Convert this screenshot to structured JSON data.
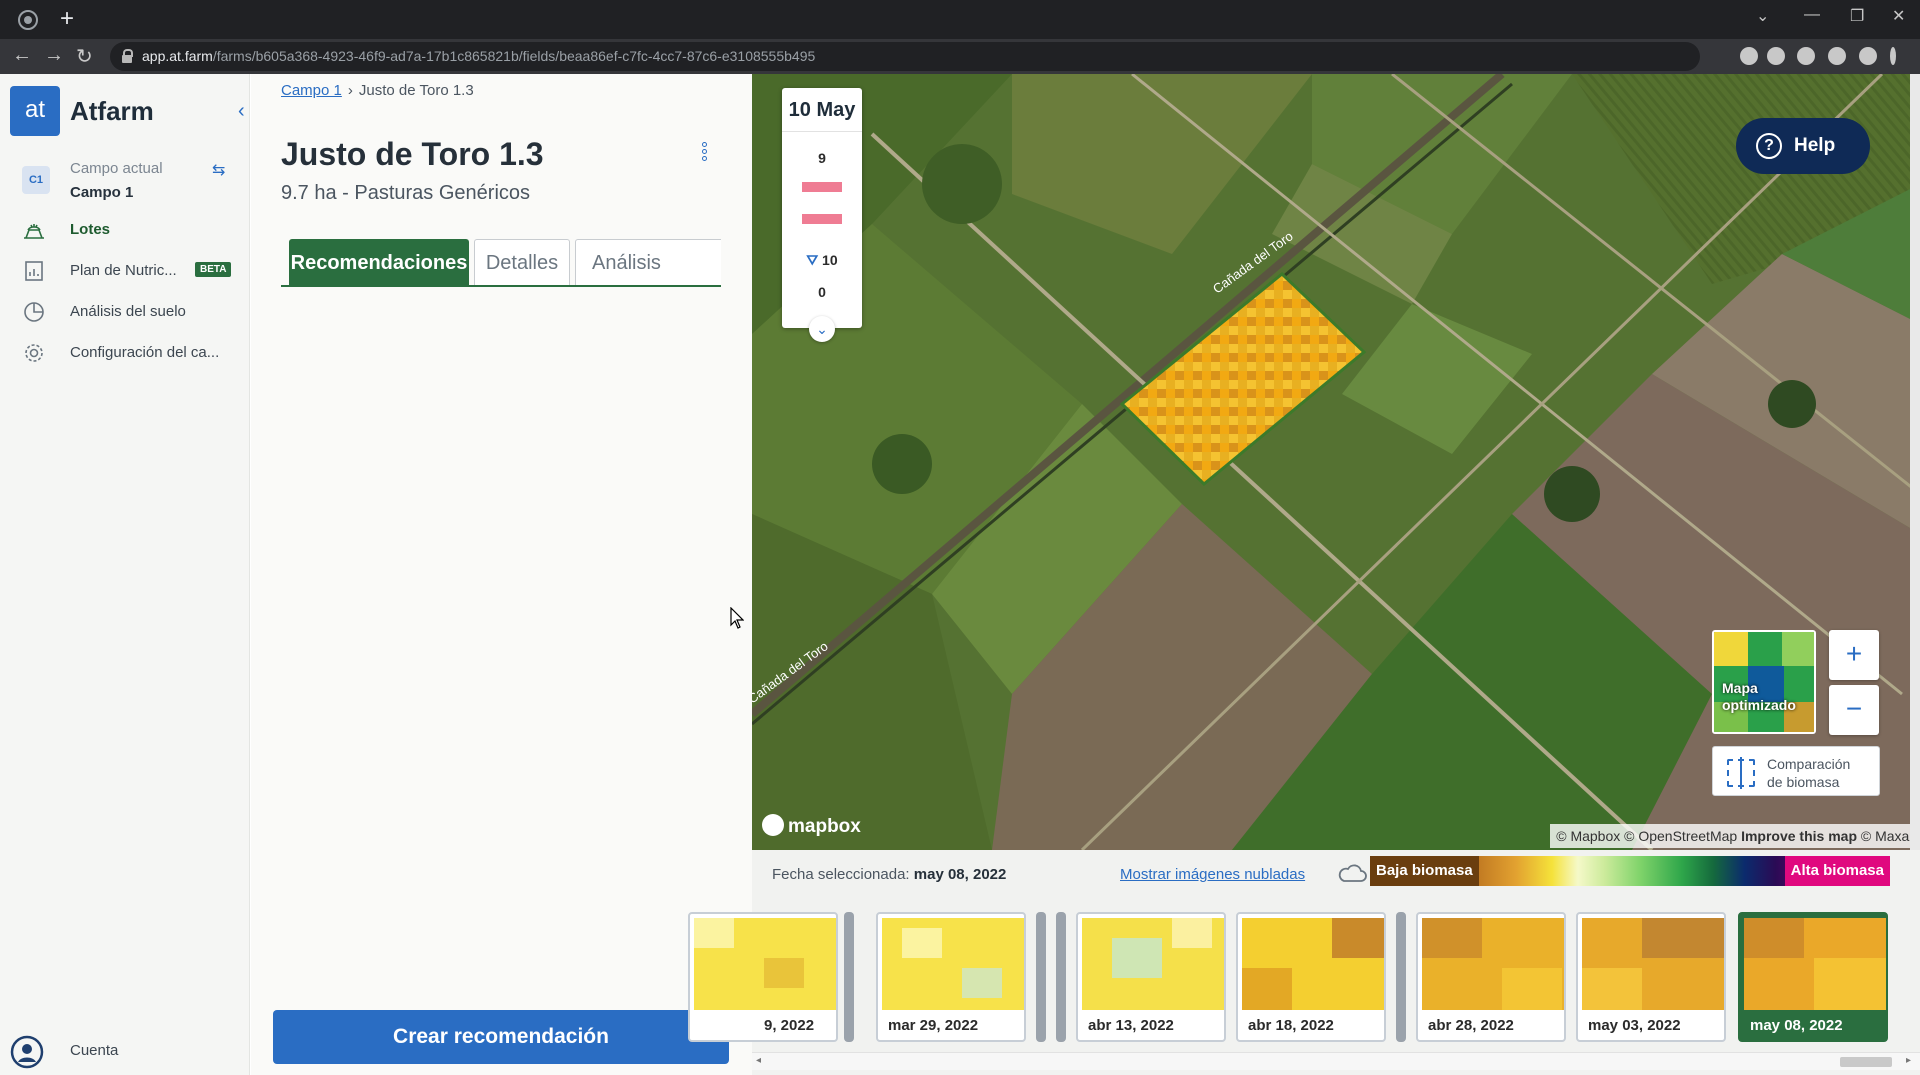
{
  "browser": {
    "url_host": "app.at.farm",
    "url_path": "/farms/b605a368-4923-46f9-ad7a-17b1c865821b/fields/beaa86ef-c7fc-4cc7-87c6-e3108555b495"
  },
  "sidebar": {
    "logo": "at",
    "app_name": "Atfarm",
    "farm_badge": "C1",
    "farm_label": "Campo actual",
    "farm_name": "Campo 1",
    "items": [
      {
        "label": "Lotes",
        "icon": "field-icon",
        "active": true
      },
      {
        "label": "Plan de Nutric...",
        "icon": "chart-icon",
        "badge": "BETA"
      },
      {
        "label": "Análisis del suelo",
        "icon": "soil-analysis-icon"
      },
      {
        "label": "Configuración del ca...",
        "icon": "gear-icon"
      }
    ],
    "account_label": "Cuenta"
  },
  "panel": {
    "breadcrumb": {
      "parent": "Campo 1",
      "current": "Justo de Toro 1.3"
    },
    "title": "Justo de Toro 1.3",
    "subtitle": "9.7 ha - Pasturas Genéricos",
    "tabs": [
      "Recomendaciones",
      "Detalles",
      "Análisis"
    ],
    "active_tab": "Recomendaciones",
    "cta": "Crear recomendación"
  },
  "map": {
    "date_card": {
      "date": "10 May",
      "top": "9",
      "wind": "10",
      "bottom": "0"
    },
    "help": "Help",
    "minimap_label_1": "Mapa",
    "minimap_label_2": "optimizado",
    "zoom_in": "+",
    "zoom_out": "−",
    "compare_1": "Comparación",
    "compare_2": "de biomasa",
    "brand": "mapbox",
    "attribution": {
      "a": "© Mapbox © OpenStreetMap",
      "b": "Improve this map",
      "c": "© Maxar"
    },
    "road_labels": [
      "Cañada del Toro",
      "Cañada del Toro"
    ]
  },
  "timeline": {
    "selected_label": "Fecha seleccionada:",
    "selected_date": "may 08, 2022",
    "cloud_link": "Mostrar imágenes nubladas",
    "legend_low": "Baja biomasa",
    "legend_high": "Alta biomasa",
    "thumbs": [
      "9, 2022",
      "mar 29, 2022",
      "abr 13, 2022",
      "abr 18, 2022",
      "abr 28, 2022",
      "may 03, 2022",
      "may 08, 2022"
    ],
    "selected_index": 6
  },
  "colors": {
    "primary": "#2a6dc3",
    "green": "#2a6e3f",
    "low_biomass": "#6a3e0f",
    "high_biomass": "#e0097f"
  }
}
